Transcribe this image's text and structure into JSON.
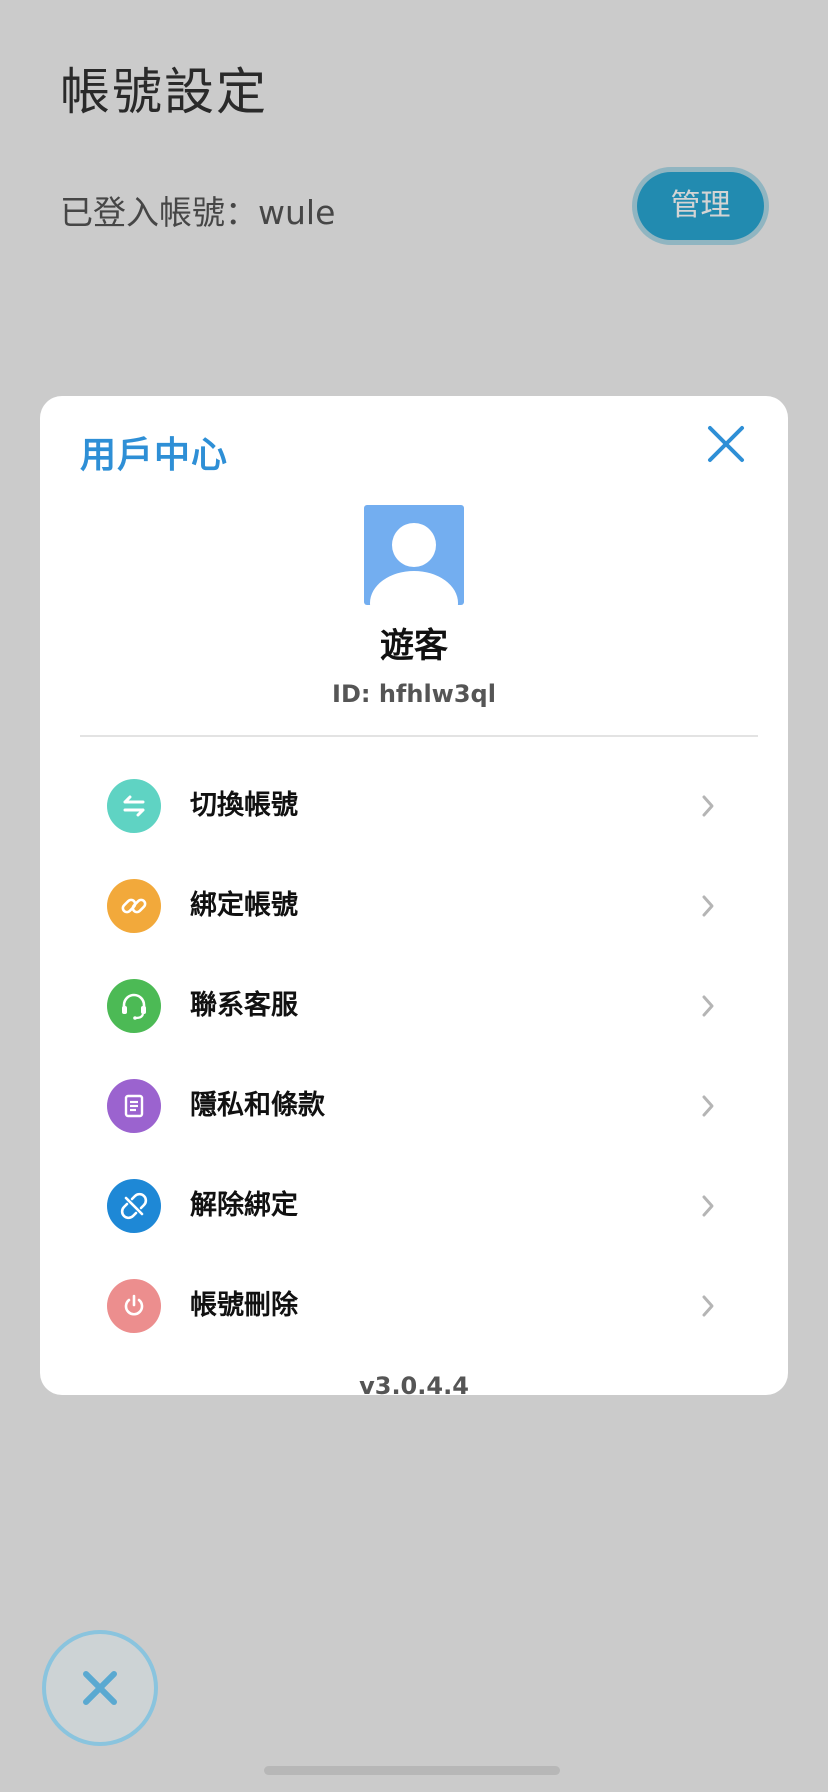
{
  "page": {
    "title": "帳號設定",
    "account_label": "已登入帳號：wule",
    "manage_button": "管理"
  },
  "modal": {
    "title": "用戶中心",
    "username": "遊客",
    "user_id": "ID: hfhlw3ql",
    "version": "v3.0.4.4",
    "menu": [
      {
        "label": "切換帳號",
        "icon": "switch-arrows-icon",
        "color": "#5fd3c3"
      },
      {
        "label": "綁定帳號",
        "icon": "link-icon",
        "color": "#f2a93b"
      },
      {
        "label": "聯系客服",
        "icon": "headset-icon",
        "color": "#4cba55"
      },
      {
        "label": "隱私和條款",
        "icon": "document-icon",
        "color": "#9b63cf"
      },
      {
        "label": "解除綁定",
        "icon": "unlink-icon",
        "color": "#1e88d6"
      },
      {
        "label": "帳號刪除",
        "icon": "power-icon",
        "color": "#ec8e8e"
      }
    ]
  },
  "colors": {
    "accent_blue": "#2e8fd6",
    "manage_button": "#2aa8d4"
  }
}
